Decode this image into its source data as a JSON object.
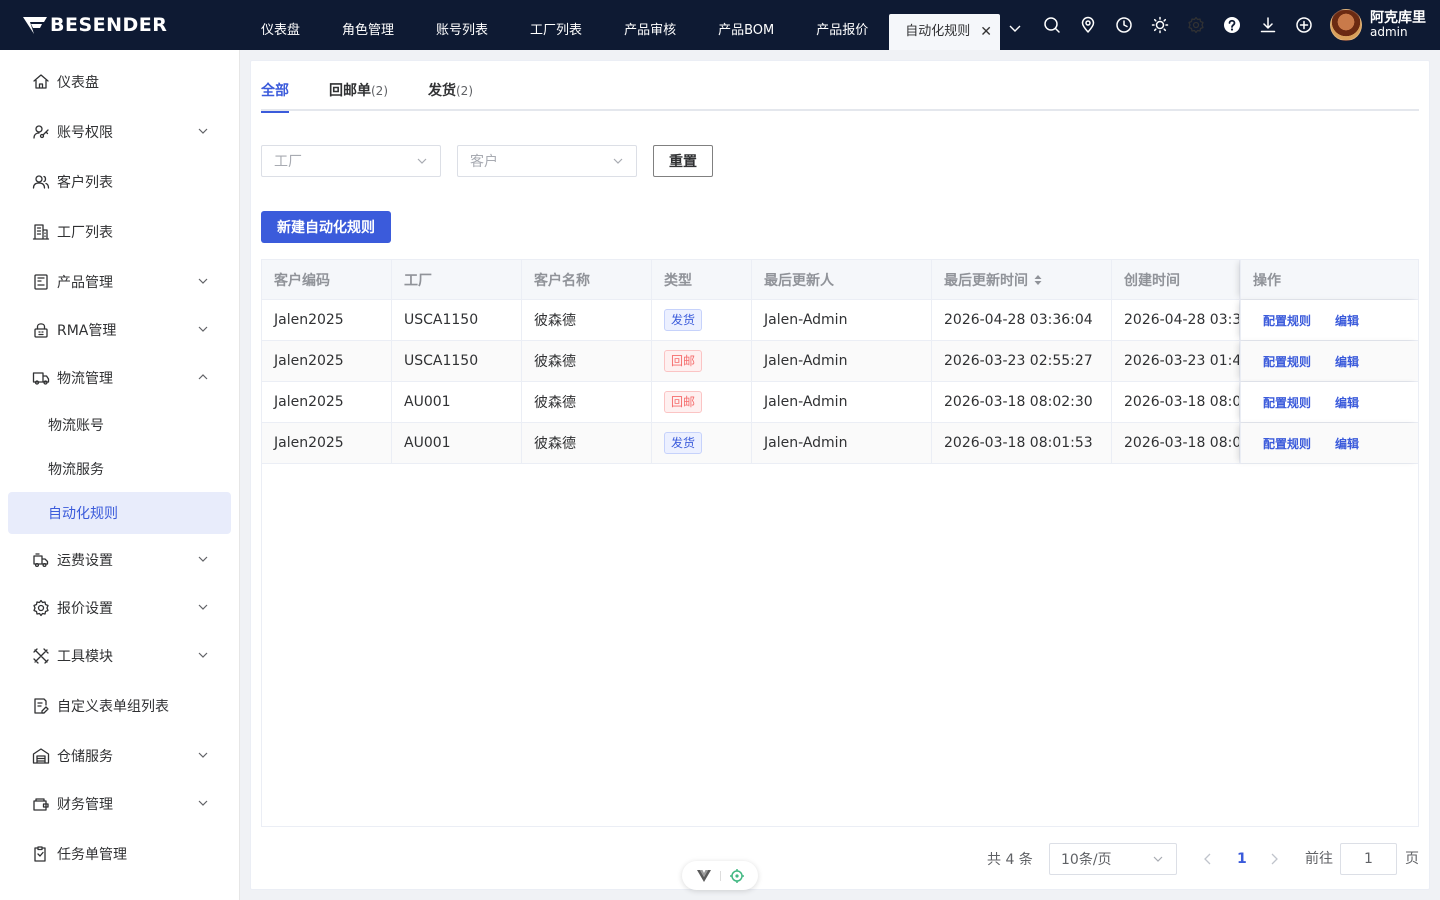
{
  "brand": {
    "name": "BESENDER"
  },
  "topnav": {
    "items": [
      "仪表盘",
      "角色管理",
      "账号列表",
      "工厂列表",
      "产品审核",
      "产品BOM",
      "产品报价"
    ],
    "active_tab": "自动化规则"
  },
  "header_icons": [
    "search-icon",
    "location-icon",
    "clock-icon",
    "sun-icon",
    "gear-icon",
    "help-icon",
    "download-icon",
    "plus-circle-icon"
  ],
  "user": {
    "name": "阿克库里",
    "role": "admin"
  },
  "sidebar": {
    "items": [
      {
        "label": "仪表盘",
        "icon": "home-icon",
        "arrow": "none"
      },
      {
        "label": "账号权限",
        "icon": "user-key-icon",
        "arrow": "down"
      },
      {
        "label": "客户列表",
        "icon": "users-icon",
        "arrow": "none"
      },
      {
        "label": "工厂列表",
        "icon": "building-icon",
        "arrow": "none"
      },
      {
        "label": "产品管理",
        "icon": "product-icon",
        "arrow": "down"
      },
      {
        "label": "RMA管理",
        "icon": "lock-icon",
        "arrow": "down"
      },
      {
        "label": "物流管理",
        "icon": "truck-icon",
        "arrow": "up"
      },
      {
        "label": "物流账号",
        "sub": true
      },
      {
        "label": "物流服务",
        "sub": true
      },
      {
        "label": "自动化规则",
        "sub": true,
        "active": true
      },
      {
        "label": "运费设置",
        "icon": "freight-icon",
        "arrow": "down"
      },
      {
        "label": "报价设置",
        "icon": "gear-icon",
        "arrow": "down"
      },
      {
        "label": "工具模块",
        "icon": "tools-icon",
        "arrow": "down"
      },
      {
        "label": "自定义表单组列表",
        "icon": "form-icon",
        "arrow": "none"
      },
      {
        "label": "仓储服务",
        "icon": "warehouse-icon",
        "arrow": "down"
      },
      {
        "label": "财务管理",
        "icon": "finance-icon",
        "arrow": "down"
      },
      {
        "label": "任务单管理",
        "icon": "task-icon",
        "arrow": "none"
      }
    ]
  },
  "tabs": [
    {
      "label": "全部",
      "count": ""
    },
    {
      "label": "回邮单",
      "count": "(2)"
    },
    {
      "label": "发货",
      "count": "(2)"
    }
  ],
  "filters": {
    "factory_placeholder": "工厂",
    "customer_placeholder": "客户",
    "reset_label": "重置"
  },
  "new_rule_label": "新建自动化规则",
  "table": {
    "columns": [
      "客户编码",
      "工厂",
      "客户名称",
      "类型",
      "最后更新人",
      "最后更新时间",
      "创建时间",
      "操作"
    ],
    "rows": [
      {
        "code": "Jalen2025",
        "factory": "USCA1150",
        "customer": "彼森德",
        "type": "发货",
        "type_kind": "ship",
        "updater": "Jalen-Admin",
        "updated": "2026-04-28 03:36:04",
        "created": "2026-04-28 03:3"
      },
      {
        "code": "Jalen2025",
        "factory": "USCA1150",
        "customer": "彼森德",
        "type": "回邮",
        "type_kind": "ret",
        "updater": "Jalen-Admin",
        "updated": "2026-03-23 02:55:27",
        "created": "2026-03-23 01:4"
      },
      {
        "code": "Jalen2025",
        "factory": "AU001",
        "customer": "彼森德",
        "type": "回邮",
        "type_kind": "ret",
        "updater": "Jalen-Admin",
        "updated": "2026-03-18 08:02:30",
        "created": "2026-03-18 08:0"
      },
      {
        "code": "Jalen2025",
        "factory": "AU001",
        "customer": "彼森德",
        "type": "发货",
        "type_kind": "ship",
        "updater": "Jalen-Admin",
        "updated": "2026-03-18 08:01:53",
        "created": "2026-03-18 08:0"
      }
    ],
    "actions": {
      "config": "配置规则",
      "edit": "编辑"
    }
  },
  "pagination": {
    "total": "共 4 条",
    "page_size": "10条/页",
    "current_page": "1",
    "goto_label": "前往",
    "goto_value": "1",
    "page_label": "页"
  },
  "colors": {
    "primary": "#3b5bdb",
    "topbar": "#0e1a33",
    "danger": "#f56c6c"
  }
}
